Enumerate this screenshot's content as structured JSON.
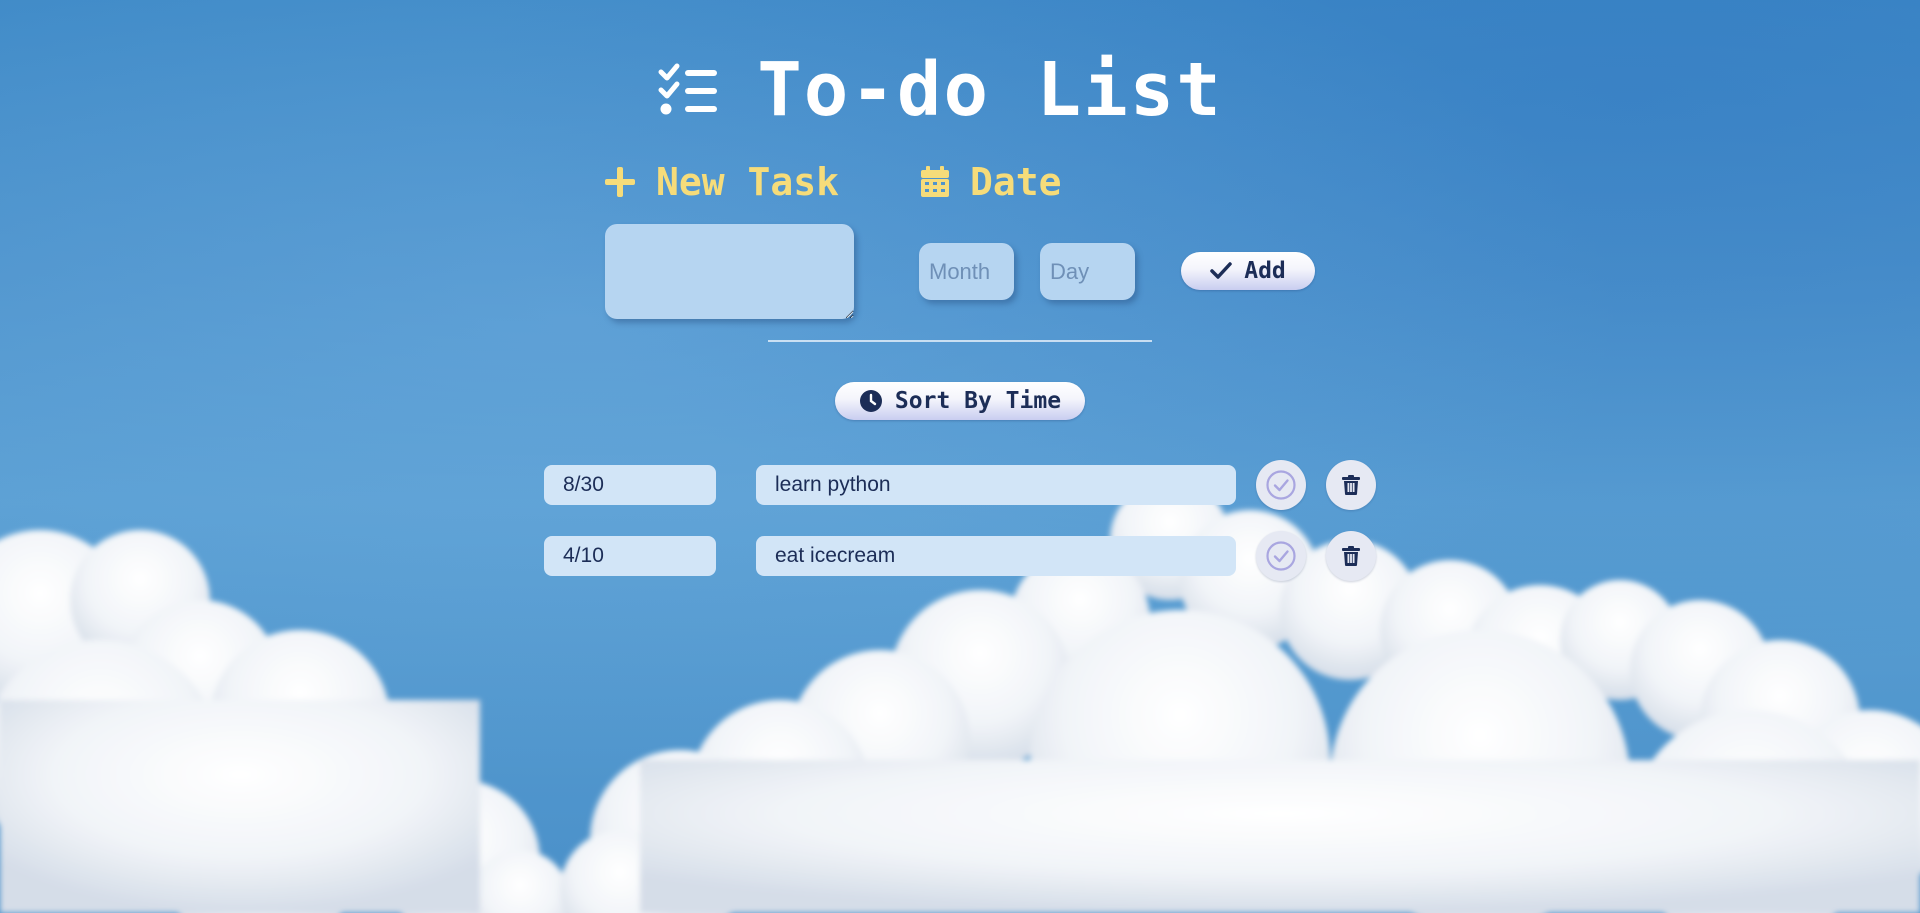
{
  "header": {
    "title": "To-do List",
    "icon": "list-check-icon"
  },
  "form": {
    "new_task_label": "New Task",
    "new_task_icon": "plus-icon",
    "date_label": "Date",
    "date_icon": "calendar-icon",
    "task_input": {
      "value": "",
      "placeholder": ""
    },
    "month_input": {
      "value": "",
      "placeholder": "Month"
    },
    "day_input": {
      "value": "",
      "placeholder": "Day"
    },
    "add_button": {
      "label": "Add",
      "icon": "check-icon"
    }
  },
  "sort": {
    "label": "Sort By Time",
    "icon": "clock-icon"
  },
  "tasks": [
    {
      "date": "8/30",
      "text": "learn python"
    },
    {
      "date": "4/10",
      "text": "eat icecream"
    }
  ],
  "colors": {
    "label_yellow": "#f6dc7a",
    "input_bg": "#b6d5f1",
    "row_bg": "#d2e5f7",
    "text_dark": "#1c2d57",
    "check_purple": "#a9a6e0"
  }
}
